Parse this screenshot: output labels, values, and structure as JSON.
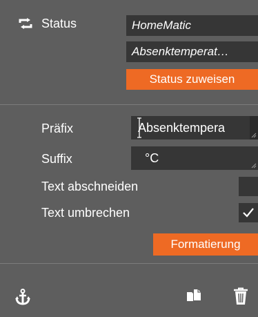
{
  "status": {
    "label": "Status",
    "source": "HomeMatic",
    "datapoint": "Absenktemperat…",
    "assign_button": "Status zuweisen",
    "icon": "swap-arrows-icon"
  },
  "format": {
    "prefix_label": "Präfix",
    "prefix_value": "Absenktempera",
    "suffix_label": "Suffix",
    "suffix_value": "°C",
    "truncate_label": "Text abschneiden",
    "truncate_checked": false,
    "wrap_label": "Text umbrechen",
    "wrap_checked": true,
    "format_button": "Formatierung"
  },
  "footer": {
    "anchor_icon": "anchor-icon",
    "copy_icon": "copy-icon",
    "delete_icon": "trash-icon"
  },
  "colors": {
    "panel_bg": "#5e5e5e",
    "field_bg": "#363636",
    "accent": "#ee6a24",
    "text": "#ffffff"
  }
}
